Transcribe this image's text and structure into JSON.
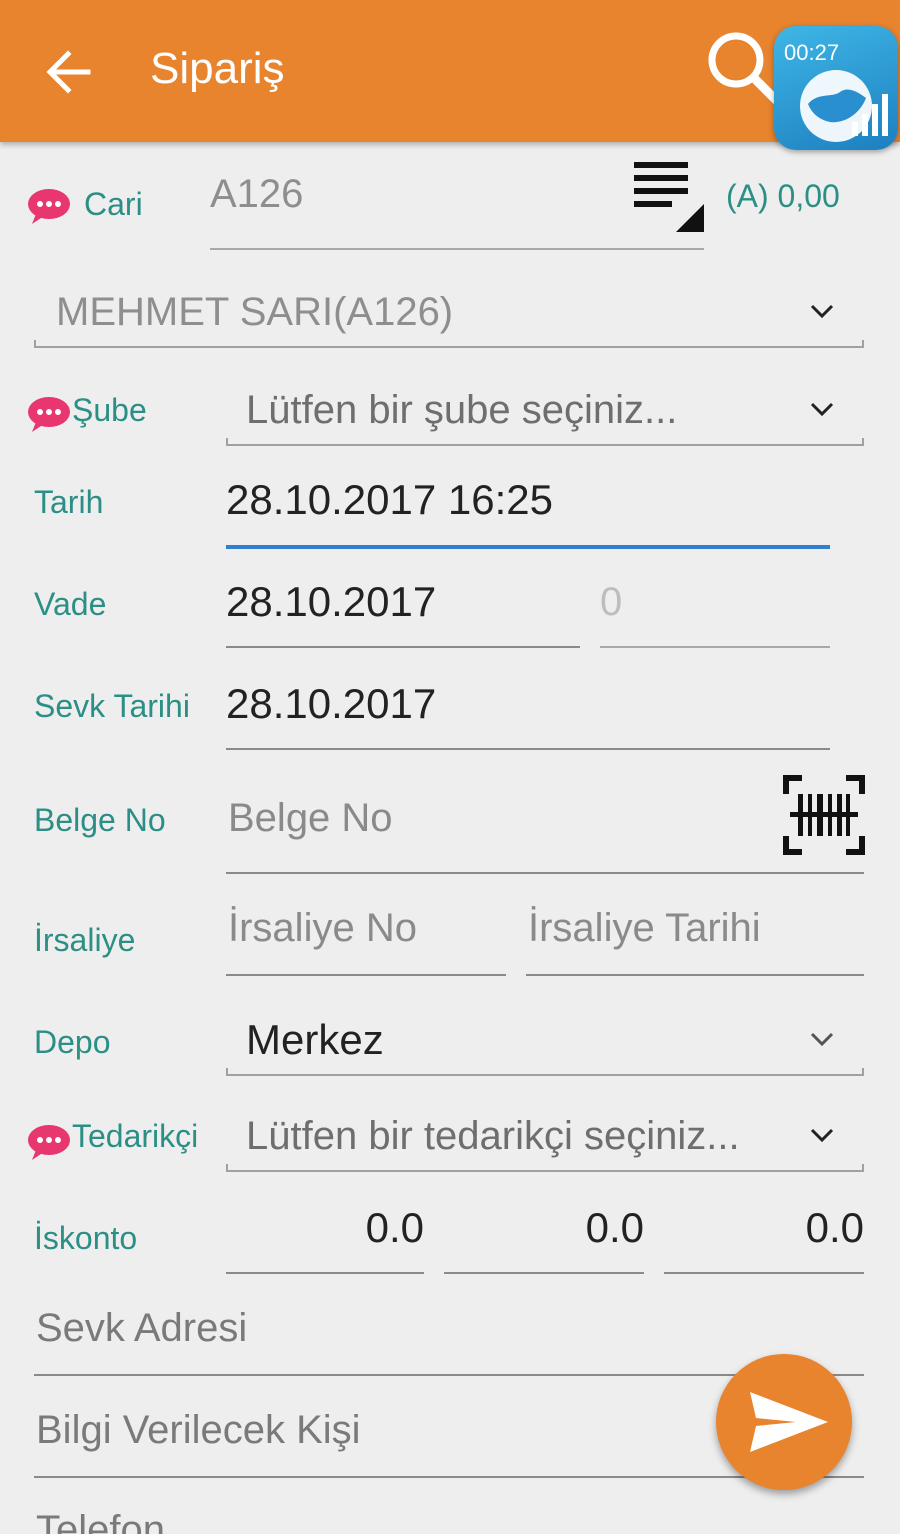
{
  "toolbar": {
    "title": "Sipariş",
    "back_icon": "arrow-left-icon",
    "search_icon": "search-icon"
  },
  "overlay": {
    "time": "00:27",
    "icon": "globe-chart-icon"
  },
  "cari": {
    "label": "Cari",
    "value": "A126",
    "balance": "(A) 0,00",
    "list_icon": "list-select-icon"
  },
  "customer": {
    "selected": "MEHMET SARI(A126)"
  },
  "sube": {
    "label": "Şube",
    "placeholder": "Lütfen bir şube seçiniz..."
  },
  "tarih": {
    "label": "Tarih",
    "value": "28.10.2017 16:25"
  },
  "vade": {
    "label": "Vade",
    "value": "28.10.2017",
    "days_placeholder": "0"
  },
  "sevk_tarihi": {
    "label": "Sevk Tarihi",
    "value": "28.10.2017"
  },
  "belge": {
    "label": "Belge No",
    "placeholder": "Belge No",
    "scan_icon": "barcode-scan-icon"
  },
  "irsaliye": {
    "label": "İrsaliye",
    "no_placeholder": "İrsaliye No",
    "date_placeholder": "İrsaliye Tarihi"
  },
  "depo": {
    "label": "Depo",
    "selected": "Merkez"
  },
  "tedarikci": {
    "label": "Tedarikçi",
    "placeholder": "Lütfen bir tedarikçi seçiniz..."
  },
  "iskonto": {
    "label": "İskonto",
    "values": [
      "0.0",
      "0.0",
      "0.0"
    ]
  },
  "sevk_adresi": {
    "placeholder": "Sevk Adresi"
  },
  "bilgi": {
    "placeholder": "Bilgi Verilecek Kişi"
  },
  "telefon": {
    "placeholder": "Telefon"
  },
  "fab": {
    "icon": "send-icon"
  },
  "colors": {
    "primary": "#e8832e",
    "label_teal": "#2b8f86",
    "note_pink": "#e8366f",
    "focus_blue": "#2f7fd1"
  }
}
